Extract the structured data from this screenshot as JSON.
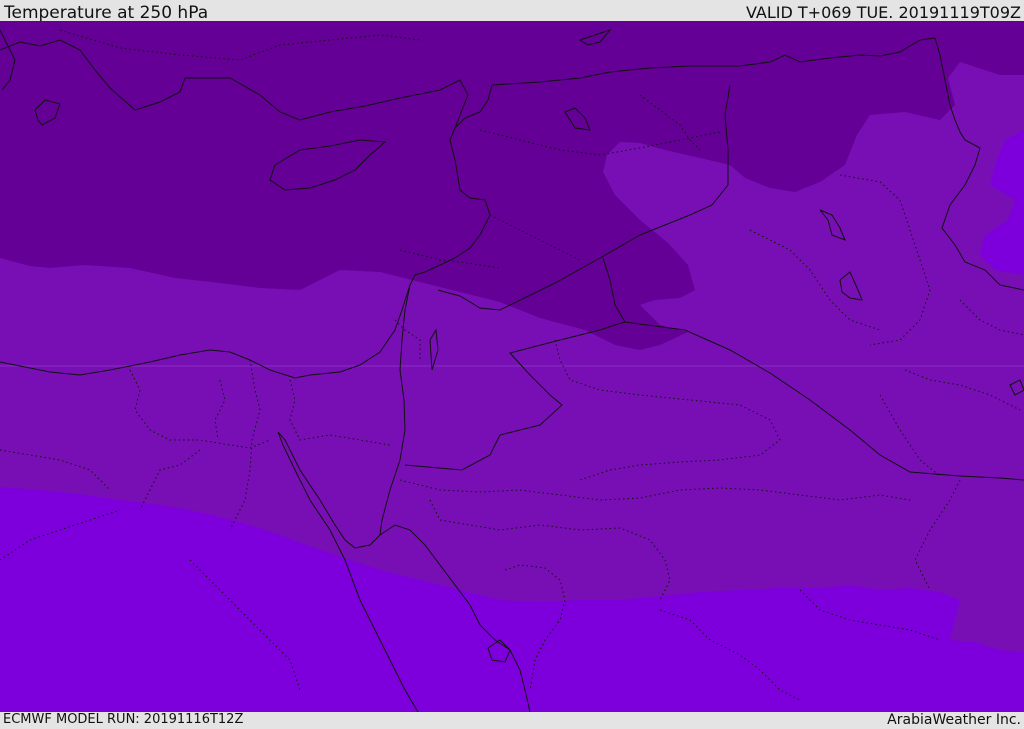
{
  "header": {
    "title": "Temperature at 250 hPa",
    "valid": "VALID T+069 TUE. 20191119T09Z"
  },
  "footer": {
    "model_run": "ECMWF MODEL RUN: 20191116T12Z",
    "credit": "ArabiaWeather Inc."
  },
  "colors": {
    "band_cold": "#640096",
    "band_mid": "#780fb4",
    "band_warm": "#7d00dc",
    "border_line": "#111111",
    "header_bg": "#e4e4e4"
  }
}
